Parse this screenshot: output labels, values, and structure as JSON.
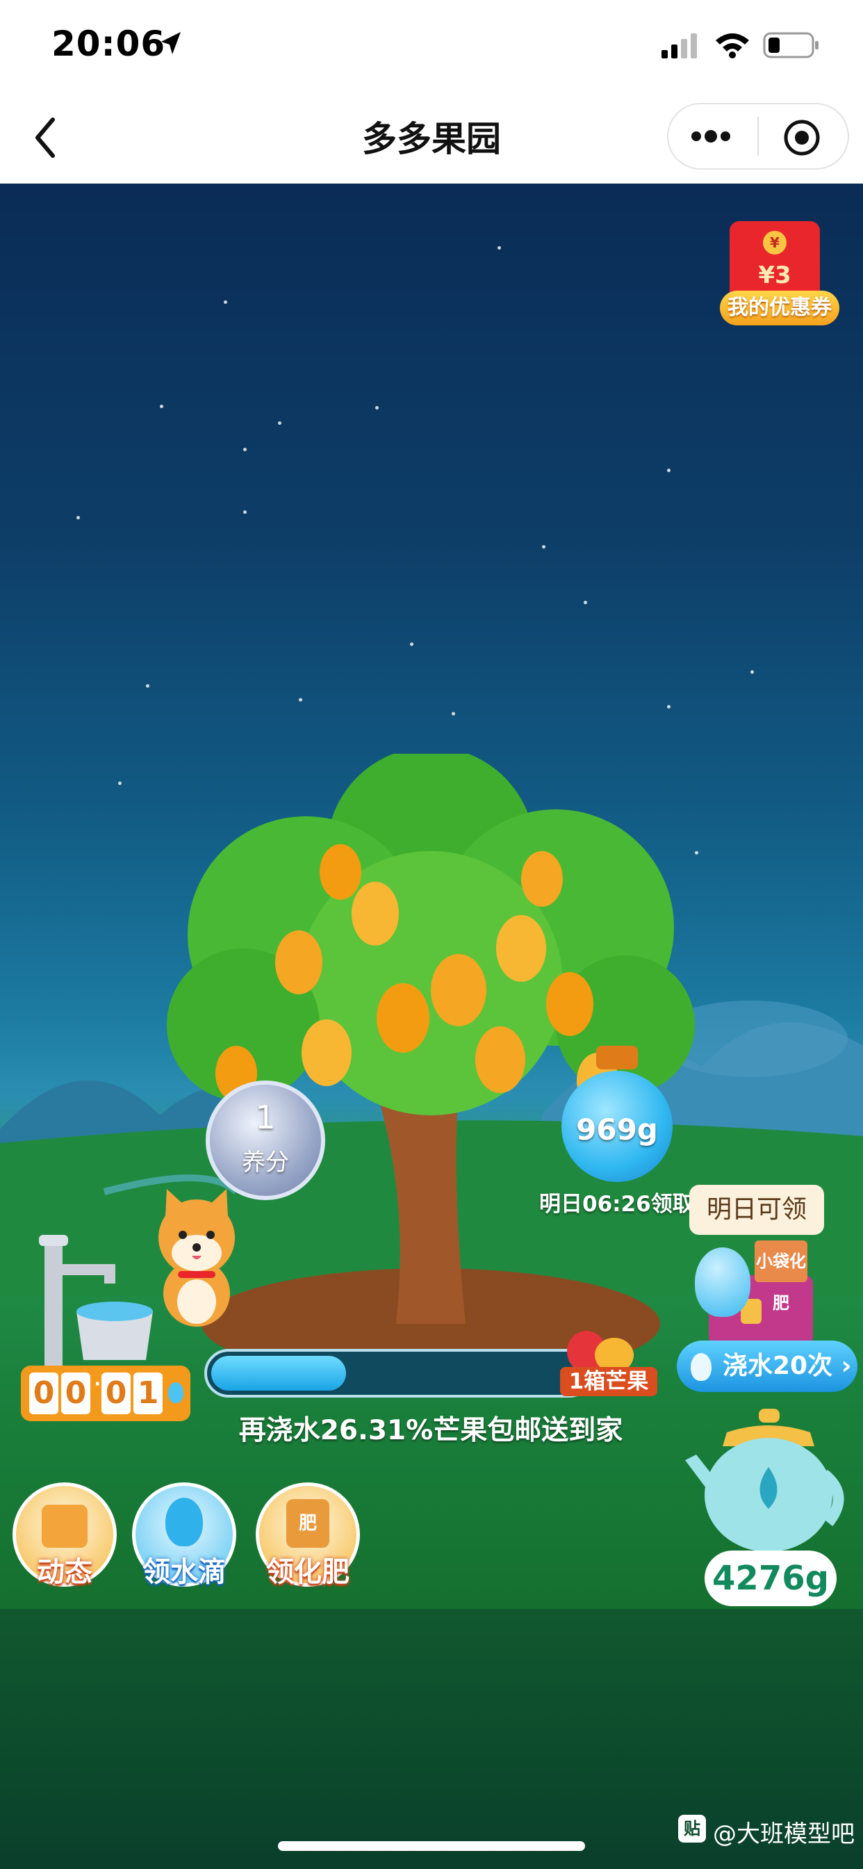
{
  "status_bar": {
    "time": "20:06"
  },
  "nav": {
    "title": "多多果园"
  },
  "coupon": {
    "amount": "¥3",
    "label": "我的优惠券"
  },
  "nutrient": {
    "value": "1",
    "unit": "养分"
  },
  "bottle": {
    "weight": "969g",
    "claim_text": "明日06:26领取"
  },
  "tomorrow_badge": "明日可领",
  "fertilizer_box": {
    "label": "小袋化肥"
  },
  "timer": {
    "d1": "0",
    "d2": "0",
    "d3": "0",
    "d4": "1"
  },
  "progress": {
    "fraction": 0.36,
    "goal_label": "1箱芒果",
    "text": "再浇水26.31%芒果包邮送到家"
  },
  "water_20": "浇水20次",
  "kettle": {
    "weight": "4276g"
  },
  "bottom_buttons": [
    {
      "label": "动态"
    },
    {
      "label": "领水滴"
    },
    {
      "label": "领化肥",
      "icon_text": "肥"
    }
  ],
  "watermark": "@大班模型吧",
  "watermark_icon_text": "贴",
  "colors": {
    "accent_orange": "#f39a1c",
    "water_blue": "#2fb7f0",
    "coupon_red": "#e8262c"
  }
}
